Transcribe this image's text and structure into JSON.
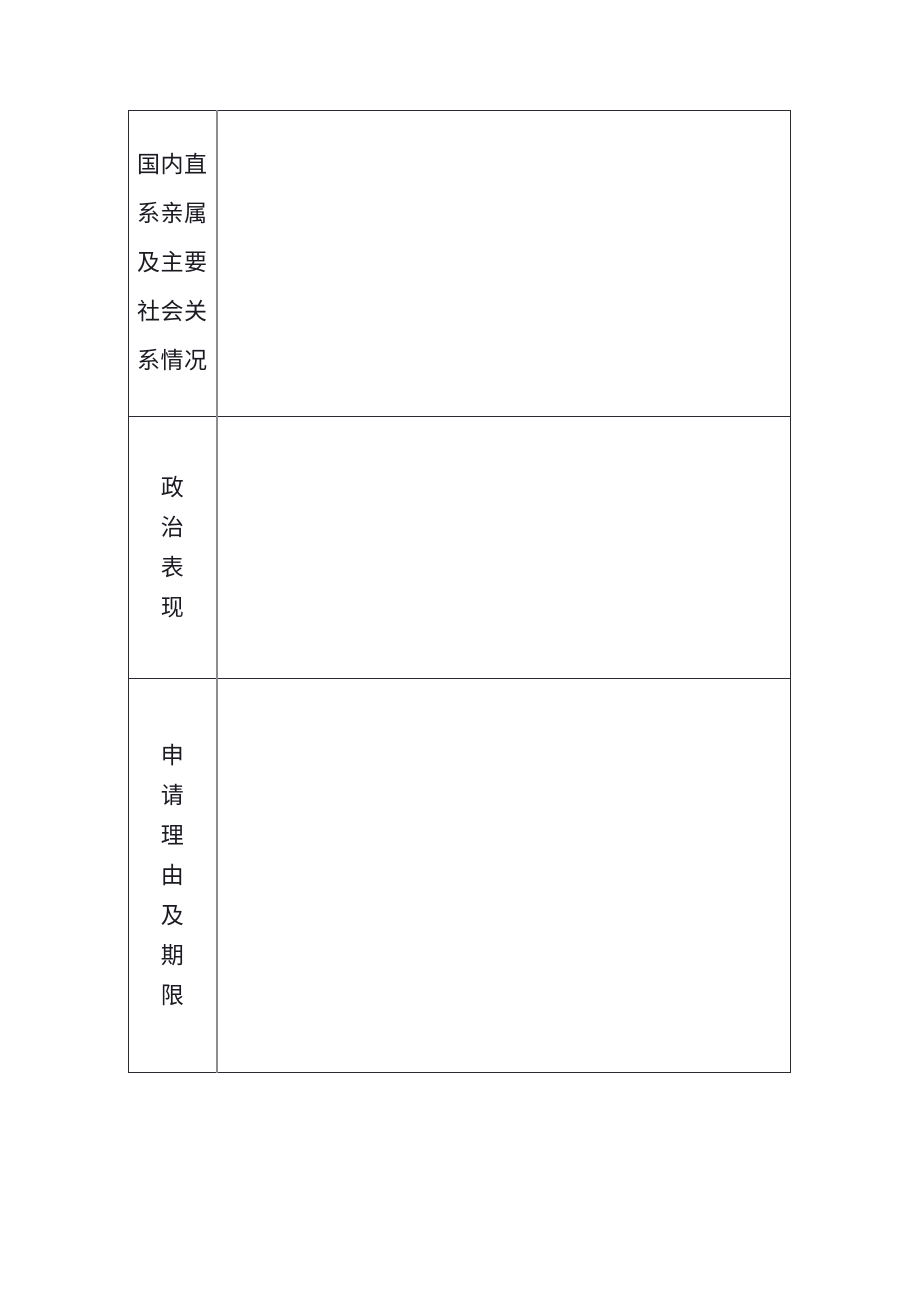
{
  "document": {
    "background_color": "#ffffff",
    "text_color": "#1a1a22",
    "border_color": "#2a2a33",
    "divider_color": "#8d8d8d"
  },
  "form": {
    "rows": [
      {
        "label": "国内直\n系亲属\n及主要\n社会关\n系情况",
        "label_plain": "国内直系亲属及主要社会关系情况",
        "content": ""
      },
      {
        "label": "政\n治\n表\n现",
        "label_plain": "政治表现",
        "content": ""
      },
      {
        "label": "申\n请\n理\n由\n及\n期\n限",
        "label_plain": "申请理由及期限",
        "content": ""
      }
    ]
  }
}
